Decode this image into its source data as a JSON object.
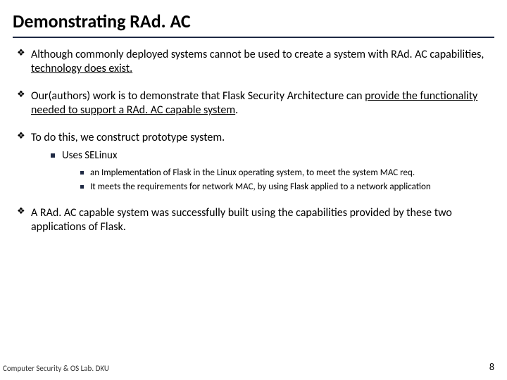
{
  "title": "Demonstrating RAd. AC",
  "bullets": {
    "b1_pre": "Although commonly deployed systems cannot be used to create a system with RAd. AC capabilities, ",
    "b1_u": "technology does exist.",
    "b2_pre": "Our(authors) work is to demonstrate that Flask Security Architecture can ",
    "b2_u": "provide the functionality needed to support a RAd. AC capable system",
    "b2_post": ".",
    "b3": "To do this, we construct prototype system.",
    "b3_sub1": "Uses SELinux",
    "b3_sub1_a": "an Implementation of Flask in the Linux operating system, to meet the system MAC req.",
    "b3_sub1_b": "It meets the requirements for network MAC, by using Flask applied to a network application",
    "b4": "A RAd. AC capable system was successfully built using the capabilities provided by these two applications of Flask."
  },
  "footer": {
    "left": "Computer Security & OS Lab. DKU",
    "page": "8"
  }
}
